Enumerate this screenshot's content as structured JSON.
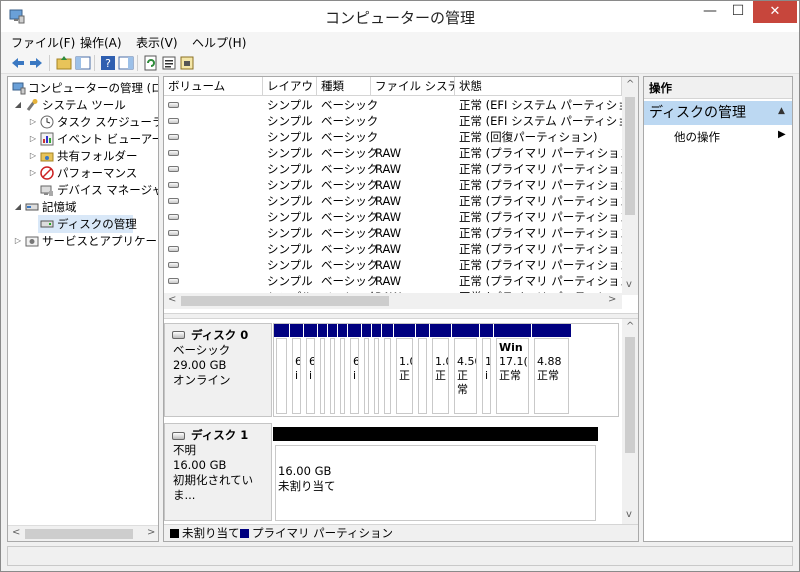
{
  "window": {
    "title": "コンピューターの管理",
    "close": "✕",
    "maximize": "☐",
    "minimize": "—"
  },
  "menu": [
    "ファイル(F)",
    "操作(A)",
    "表示(V)",
    "ヘルプ(H)"
  ],
  "tree": [
    {
      "label": "コンピューターの管理 (ローカル)",
      "arrow": "",
      "icon": "computer-management-icon",
      "selected": false
    },
    {
      "label": "システム ツール",
      "arrow": "◢",
      "icon": "system-tools-icon",
      "selected": false
    },
    {
      "label": "タスク スケジューラ",
      "arrow": "▷",
      "icon": "task-scheduler-icon",
      "selected": false
    },
    {
      "label": "イベント ビューアー",
      "arrow": "▷",
      "icon": "event-viewer-icon",
      "selected": false
    },
    {
      "label": "共有フォルダー",
      "arrow": "▷",
      "icon": "shared-folders-icon",
      "selected": false
    },
    {
      "label": "パフォーマンス",
      "arrow": "▷",
      "icon": "performance-icon",
      "selected": false
    },
    {
      "label": "デバイス マネージャー",
      "arrow": "",
      "icon": "device-manager-icon",
      "selected": false
    },
    {
      "label": "記憶域",
      "arrow": "◢",
      "icon": "storage-icon",
      "selected": false
    },
    {
      "label": "ディスクの管理",
      "arrow": "",
      "icon": "disk-management-icon",
      "selected": true
    },
    {
      "label": "サービスとアプリケーション",
      "arrow": "▷",
      "icon": "services-apps-icon",
      "selected": false
    }
  ],
  "volume_table": {
    "columns": [
      "ボリューム",
      "レイアウト",
      "種類",
      "ファイル システム",
      "状態"
    ],
    "rows": [
      {
        "volume": "",
        "layout": "シンプル",
        "type": "ベーシック",
        "fs": "",
        "status": "正常 (EFI システム パーティション)"
      },
      {
        "volume": "",
        "layout": "シンプル",
        "type": "ベーシック",
        "fs": "",
        "status": "正常 (EFI システム パーティション)"
      },
      {
        "volume": "",
        "layout": "シンプル",
        "type": "ベーシック",
        "fs": "",
        "status": "正常 (回復パーティション)"
      },
      {
        "volume": "",
        "layout": "シンプル",
        "type": "ベーシック",
        "fs": "RAW",
        "status": "正常 (プライマリ パーティション)"
      },
      {
        "volume": "",
        "layout": "シンプル",
        "type": "ベーシック",
        "fs": "RAW",
        "status": "正常 (プライマリ パーティション)"
      },
      {
        "volume": "",
        "layout": "シンプル",
        "type": "ベーシック",
        "fs": "RAW",
        "status": "正常 (プライマリ パーティション)"
      },
      {
        "volume": "",
        "layout": "シンプル",
        "type": "ベーシック",
        "fs": "RAW",
        "status": "正常 (プライマリ パーティション)"
      },
      {
        "volume": "",
        "layout": "シンプル",
        "type": "ベーシック",
        "fs": "RAW",
        "status": "正常 (プライマリ パーティション)"
      },
      {
        "volume": "",
        "layout": "シンプル",
        "type": "ベーシック",
        "fs": "RAW",
        "status": "正常 (プライマリ パーティション)"
      },
      {
        "volume": "",
        "layout": "シンプル",
        "type": "ベーシック",
        "fs": "RAW",
        "status": "正常 (プライマリ パーティション)"
      },
      {
        "volume": "",
        "layout": "シンプル",
        "type": "ベーシック",
        "fs": "RAW",
        "status": "正常 (プライマリ パーティション)"
      },
      {
        "volume": "",
        "layout": "シンプル",
        "type": "ベーシック",
        "fs": "RAW",
        "status": "正常 (プライマリ パーティション)"
      },
      {
        "volume": "",
        "layout": "シンプル",
        "type": "ベーシック",
        "fs": "RAW",
        "status": "正常 (プライマリ パーティション)"
      }
    ]
  },
  "disks": [
    {
      "name": "ディスク 0",
      "kind": "ベーシック",
      "size": "29.00 GB",
      "state": "オンライン",
      "partitions": [
        {
          "lines": [
            "",
            ""
          ]
        },
        {
          "lines": [
            "6",
            "i"
          ]
        },
        {
          "lines": [
            "6",
            "i"
          ]
        },
        {
          "lines": [
            "",
            ""
          ]
        },
        {
          "lines": [
            "",
            ""
          ]
        },
        {
          "lines": [
            "",
            ""
          ]
        },
        {
          "lines": [
            "6",
            "i"
          ]
        },
        {
          "lines": [
            "",
            ""
          ]
        },
        {
          "lines": [
            "",
            ""
          ]
        },
        {
          "lines": [
            "",
            ""
          ]
        },
        {
          "lines": [
            "1.0",
            "正"
          ]
        },
        {
          "lines": [
            "",
            ""
          ]
        },
        {
          "lines": [
            "1.0",
            "正"
          ]
        },
        {
          "lines": [
            "4.50",
            "正常"
          ]
        },
        {
          "lines": [
            "1",
            "i"
          ]
        },
        {
          "lines": [
            "Win",
            "17.1(",
            "正常"
          ]
        },
        {
          "lines": [
            "4.88",
            "正常"
          ]
        }
      ]
    },
    {
      "name": "ディスク 1",
      "kind": "不明",
      "size": "16.00 GB",
      "state": "初期化されていま...",
      "partitions": [
        {
          "lines": [
            "16.00 GB",
            "未割り当て"
          ]
        }
      ]
    }
  ],
  "legend": {
    "unallocated": "未割り当て",
    "primary": "プライマリ パーティション"
  },
  "actions": {
    "header": "操作",
    "section": "ディスクの管理",
    "more": "他の操作",
    "more_arrow": "▶"
  },
  "scroll": {
    "left": "<",
    "right": ">",
    "up": "^",
    "down": "v"
  },
  "colors": {
    "primary_partition": "#000080",
    "unallocated": "#000000",
    "action_section": "#bcd8f2"
  }
}
